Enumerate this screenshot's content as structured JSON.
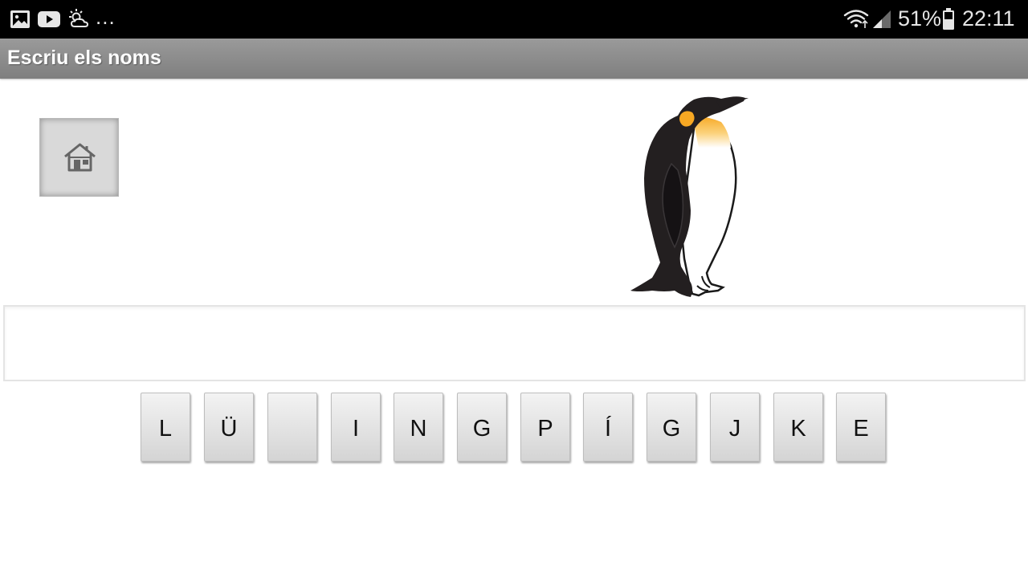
{
  "status_bar": {
    "icons": [
      "image-icon",
      "youtube-icon",
      "weather-icon"
    ],
    "ellipsis": "...",
    "battery_percent": "51%",
    "time": "22:11"
  },
  "action_bar": {
    "title": "Escriu els noms"
  },
  "home_button": {
    "icon": "home-icon"
  },
  "answer": {
    "value": ""
  },
  "letters": [
    "L",
    "Ü",
    "",
    "I",
    "N",
    "G",
    "P",
    "Í",
    "G",
    "J",
    "K",
    "E"
  ],
  "colors": {
    "status_bar": "#000000",
    "action_bar": "#8f8f8f",
    "tile": "#e3e3e3"
  }
}
